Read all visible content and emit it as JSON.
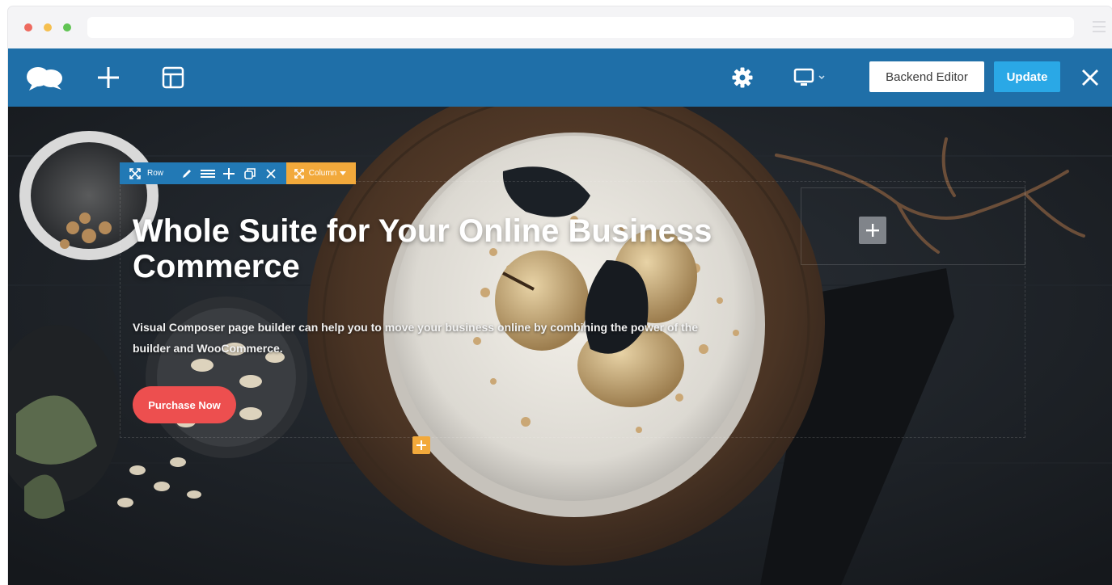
{
  "toolbar": {
    "backend_editor_label": "Backend Editor",
    "update_label": "Update",
    "icons": [
      "cloud-logo-icon",
      "plus-icon",
      "layout-icon",
      "gear-icon",
      "monitor-icon",
      "chevron-down-icon",
      "close-icon"
    ]
  },
  "controls": {
    "row_label": "Row",
    "column_label": "Column",
    "row_icons": [
      "move-icon",
      "pencil-icon",
      "menu-icon",
      "plus-icon",
      "clone-icon",
      "close-icon"
    ],
    "column_icons": [
      "move-icon",
      "chevron-down-icon"
    ]
  },
  "hero": {
    "headline": "Whole Suite for Your Online Business Commerce",
    "subtitle": "Visual Composer page builder can help you to move your business online by combining the power of the builder and WooCommerce.",
    "cta_label": "Purchase Now"
  },
  "colors": {
    "toolbar_bg": "#1f6fa8",
    "update_button": "#2aa8e6",
    "row_control": "#2279b5",
    "column_control": "#f2a93b",
    "cta_button": "#ed4f4f"
  }
}
